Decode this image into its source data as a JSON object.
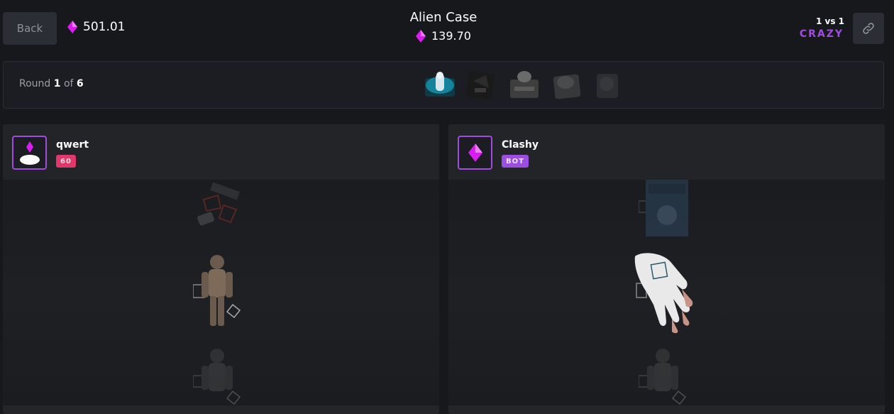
{
  "header": {
    "back_label": "Back",
    "balance": "501.01",
    "case_title": "Alien Case",
    "case_price": "139.70",
    "mode_vs": "1 vs 1",
    "mode_name": "CRAZY"
  },
  "round": {
    "label": "Round",
    "current": "1",
    "of": "of",
    "total": "6"
  },
  "players": [
    {
      "name": "qwert",
      "badge": "60",
      "items": [
        "gun-item",
        "astronaut-suit-item",
        "astronaut-suit-item"
      ]
    },
    {
      "name": "Clashy",
      "badge": "BOT",
      "items": [
        "level-banner-item",
        "white-glove-item",
        "astronaut-suit-item"
      ]
    }
  ],
  "colors": {
    "accent": "#a04ddf",
    "gem": "#d91cf2",
    "level_badge": "#e0386a",
    "bot_badge": "#9b4ee0"
  }
}
